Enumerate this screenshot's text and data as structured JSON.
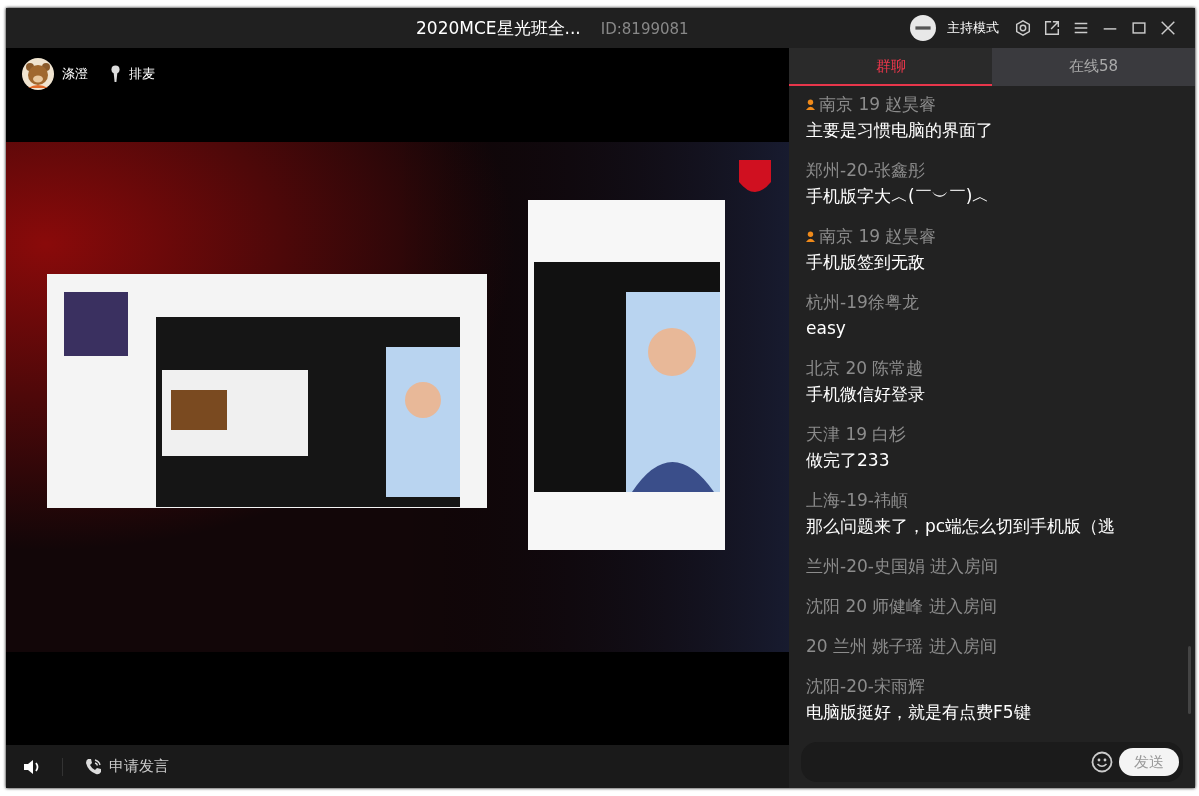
{
  "window": {
    "title": "2020MCE星光班全...",
    "room_id": "ID:8199081",
    "mode_label": "主持模式"
  },
  "stage": {
    "host_name": "涤澄",
    "queue_label": "排麦"
  },
  "bottom_bar": {
    "request_label": "申请发言"
  },
  "tabs": [
    {
      "label": "群聊",
      "selected": true
    },
    {
      "label": "在线58",
      "selected": false
    }
  ],
  "chat": [
    {
      "kind": "message",
      "host": true,
      "name": "南京 19 赵昊睿",
      "text": "主要是习惯电脑的界面了"
    },
    {
      "kind": "message",
      "host": false,
      "name": "郑州-20-张鑫彤",
      "text": "手机版字大︿(￣︶￣)︿"
    },
    {
      "kind": "message",
      "host": true,
      "name": "南京 19 赵昊睿",
      "text": "手机版签到无敌"
    },
    {
      "kind": "message",
      "host": false,
      "name": "杭州-19徐粤龙",
      "text": "easy"
    },
    {
      "kind": "message",
      "host": false,
      "name": "北京 20 陈常越",
      "text": "手机微信好登录"
    },
    {
      "kind": "message",
      "host": false,
      "name": "天津 19 白杉",
      "text": "做完了233"
    },
    {
      "kind": "message",
      "host": false,
      "name": "上海-19-祎頔",
      "text": "那么问题来了，pc端怎么切到手机版（逃"
    },
    {
      "kind": "join",
      "name": "兰州-20-史国娟 进入房间"
    },
    {
      "kind": "join",
      "name": "沈阳 20 师健峰 进入房间"
    },
    {
      "kind": "join",
      "name": "20  兰州  姚子瑶 进入房间"
    },
    {
      "kind": "message",
      "host": false,
      "name": "沈阳-20-宋雨辉",
      "text": "电脑版挺好，就是有点费F5键"
    }
  ],
  "composer": {
    "send_label": "发送"
  }
}
